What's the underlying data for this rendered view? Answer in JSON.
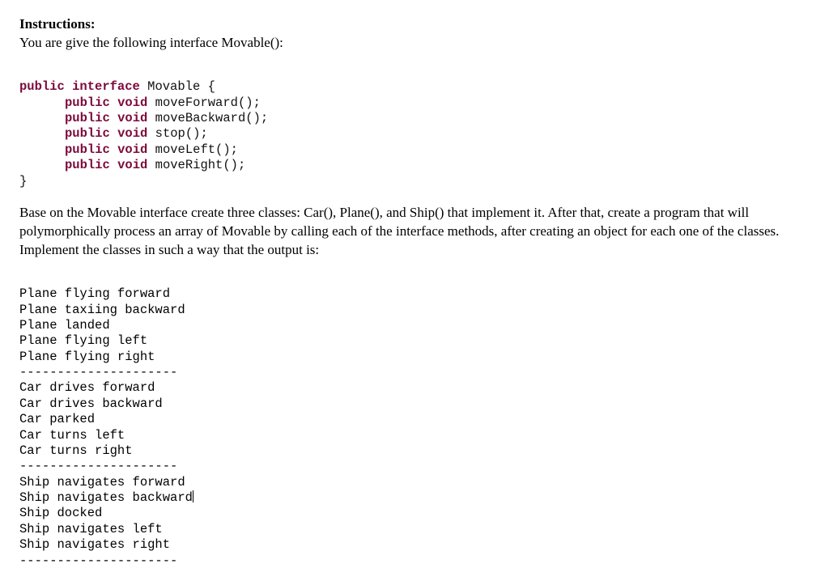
{
  "header": {
    "title": "Instructions:",
    "prompt": "You are give the following interface Movable():"
  },
  "code": {
    "kw_public": "public",
    "kw_interface": "interface",
    "kw_void": "void",
    "class_name": "Movable",
    "open_brace": " {",
    "close_brace": "}",
    "m1": " moveForward();",
    "m2": " moveBackward();",
    "m3": " stop();",
    "m4": " moveLeft();",
    "m5": " moveRight();"
  },
  "body": {
    "text": "Base on the Movable interface create three classes: Car(), Plane(), and Ship() that implement it. After that, create a program that will polymorphically process an array of Movable by calling each of the interface methods, after creating an object for each one of the classes. Implement the classes in such a way that the output is:"
  },
  "output": {
    "lines": [
      "Plane flying forward",
      "Plane taxiing backward",
      "Plane landed",
      "Plane flying left",
      "Plane flying right",
      "---------------------",
      "Car drives forward",
      "Car drives backward",
      "Car parked",
      "Car turns left",
      "Car turns right",
      "---------------------",
      "Ship navigates forward",
      "Ship navigates backward",
      "Ship docked",
      "Ship navigates left",
      "Ship navigates right",
      "---------------------"
    ]
  }
}
